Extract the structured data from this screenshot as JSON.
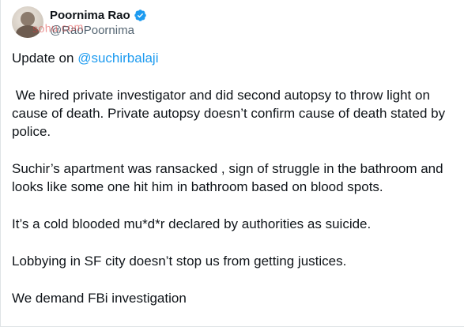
{
  "author": {
    "display_name": "Poornima Rao",
    "handle": "@RaoPoornima",
    "avatar_icon": "avatar-photo",
    "verified_icon": "verified-badge-icon",
    "verified_color": "#1d9bf0"
  },
  "watermark": {
    "text": "sohu.com"
  },
  "tweet": {
    "line1_prefix": "Update on ",
    "mention": "@suchirbalaji",
    "paragraphs": [
      " We hired private investigator and did second autopsy to throw light on cause of death. Private autopsy doesn’t confirm cause of death stated by police.",
      "Suchir’s apartment was ransacked , sign of struggle in the bathroom and looks like some one hit him in bathroom based on blood spots.",
      "It’s a cold blooded mu*d*r declared by authorities as suicide.",
      "Lobbying in SF city doesn’t stop us from getting justices.",
      "We demand FBi investigation"
    ]
  },
  "colors": {
    "text": "#0f1419",
    "secondary": "#536471",
    "link": "#1d9bf0"
  }
}
